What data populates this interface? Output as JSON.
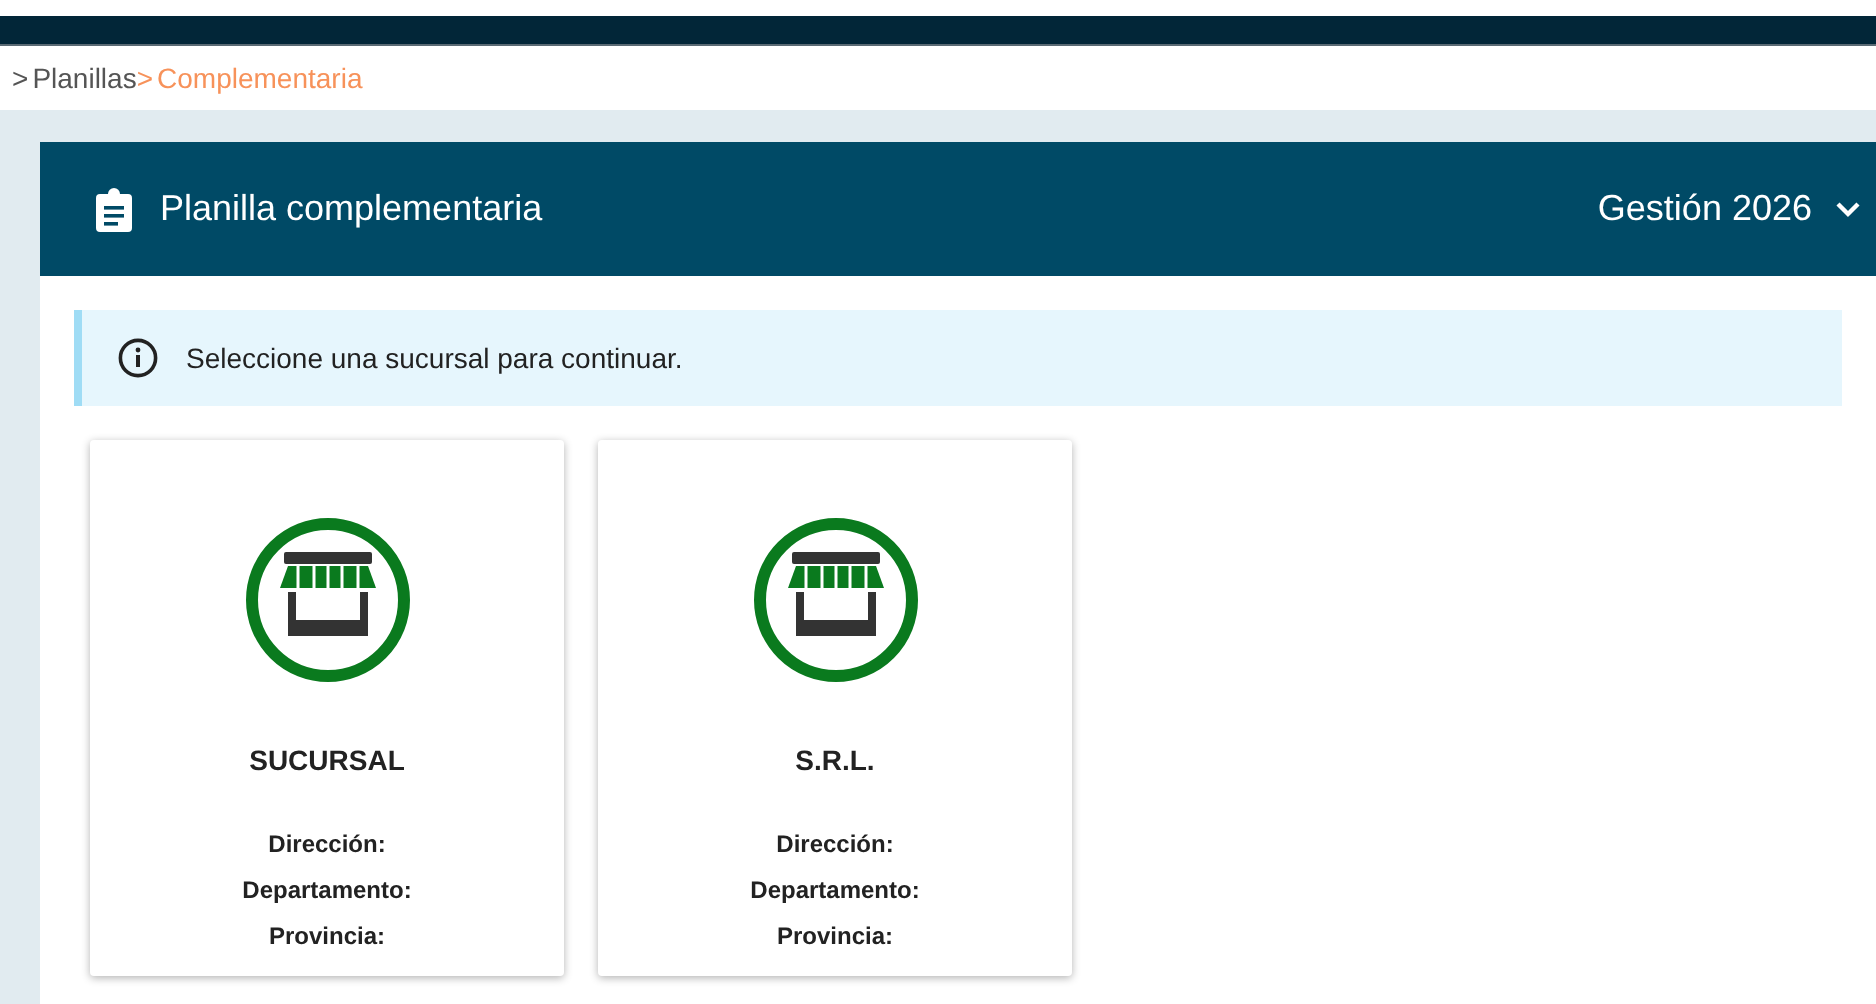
{
  "breadcrumb": [
    {
      "prefix": ">",
      "label": "Planillas",
      "selected": false
    },
    {
      "prefix": ">",
      "label": "Complementaria",
      "selected": true
    }
  ],
  "panel": {
    "title": "Planilla complementaria",
    "year_selector": "Gestión 2026"
  },
  "alert": {
    "text": "Seleccione una sucursal para continuar."
  },
  "branches": [
    {
      "name": "SUCURSAL",
      "fields": [
        "Dirección:",
        "Departamento:",
        "Provincia:"
      ]
    },
    {
      "name": "S.R.L.",
      "fields": [
        "Dirección:",
        "Departamento:",
        "Provincia:"
      ]
    }
  ]
}
